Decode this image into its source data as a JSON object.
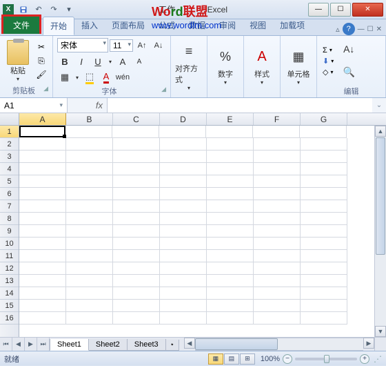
{
  "titlebar": {
    "app_prefix": "工作",
    "app_suffix": "Excel"
  },
  "watermark": {
    "line1_a": "Wo",
    "line1_b": "rd",
    "line1_c": "联盟",
    "line1_a_color": "#d01818",
    "line1_b_color": "#1a7a1a",
    "line1_c_color": "#d01818",
    "line2": "www.wordlm.com"
  },
  "system_buttons": {
    "min": "—",
    "max": "☐",
    "close": "✕"
  },
  "ribbon": {
    "file": "文件",
    "tabs": [
      "开始",
      "插入",
      "页面布局",
      "公式",
      "数据",
      "审阅",
      "视图",
      "加载项"
    ],
    "active_tab": 0,
    "groups": {
      "clipboard": {
        "paste": "粘贴",
        "label": "剪贴板"
      },
      "font": {
        "name": "宋体",
        "size": "11",
        "bold": "B",
        "italic": "I",
        "underline": "U",
        "label": "字体"
      },
      "alignment": {
        "btn": "对齐方式"
      },
      "number": {
        "btn": "数字",
        "symbol": "%"
      },
      "styles": {
        "btn": "样式"
      },
      "cells": {
        "btn": "单元格"
      },
      "editing": {
        "sum": "Σ",
        "fill": "⬇",
        "clear": "◇",
        "label": "编辑"
      }
    }
  },
  "formula_bar": {
    "name_box": "A1",
    "fx_label": "fx",
    "formula": ""
  },
  "grid": {
    "columns": [
      "A",
      "B",
      "C",
      "D",
      "E",
      "F",
      "G"
    ],
    "rows": [
      1,
      2,
      3,
      4,
      5,
      6,
      7,
      8,
      9,
      10,
      11,
      12,
      13,
      14,
      15,
      16
    ],
    "active_cell": {
      "row": 1,
      "col": "A"
    }
  },
  "sheets": {
    "nav": [
      "⏮",
      "◀",
      "▶",
      "⏭"
    ],
    "tabs": [
      "Sheet1",
      "Sheet2",
      "Sheet3"
    ],
    "active": 0
  },
  "statusbar": {
    "ready": "就绪",
    "zoom_pct": "100%",
    "minus": "−",
    "plus": "+"
  }
}
